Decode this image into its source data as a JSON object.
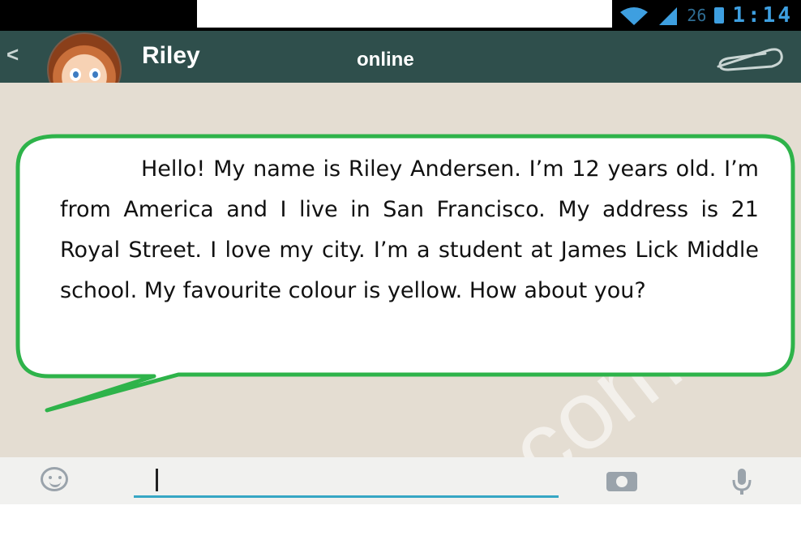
{
  "status_bar": {
    "signal_count": "26",
    "time": "1:14"
  },
  "header": {
    "back_icon": "<",
    "contact_name": "Riley",
    "contact_status": "online"
  },
  "message": {
    "text": "Hello! My name is Riley Andersen. I’m 12 years old. I’m from America and I live in San Francisco. My address is 21 Royal Street. I love my city. I’m a student at James Lick Middle school. My favourite colour is yellow. How about you?"
  },
  "composer": {
    "value": ""
  },
  "colors": {
    "header": "#2f4f4c",
    "bubble_border": "#2eb34a",
    "input_underline": "#36a6c4"
  },
  "icons": [
    "back-arrow-icon",
    "avatar",
    "paperclip-icon",
    "emoji-icon",
    "camera-icon",
    "microphone-icon",
    "wifi-icon",
    "signal-icon",
    "battery-icon"
  ]
}
